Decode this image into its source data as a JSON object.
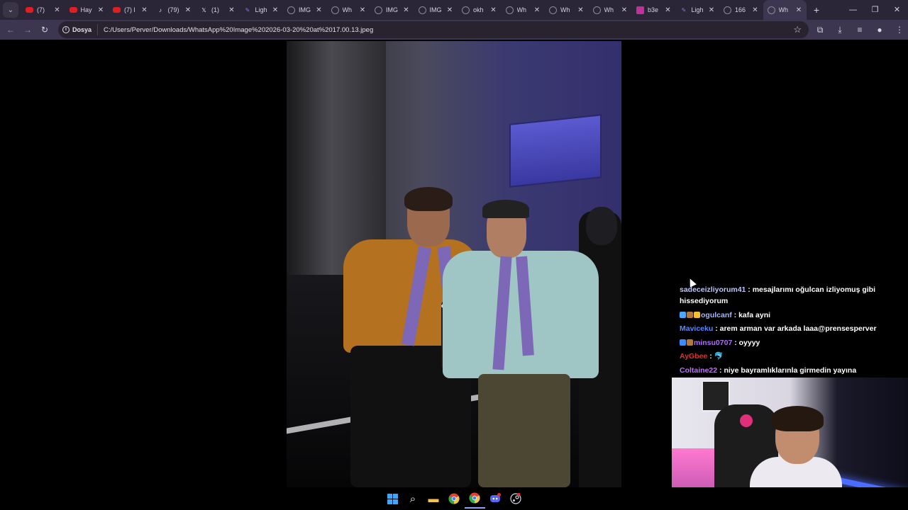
{
  "browser": {
    "tabs": [
      {
        "label": "(7) ",
        "favicon": "youtube-icon",
        "color": "#e02020"
      },
      {
        "label": "Hay",
        "favicon": "youtube-icon",
        "color": "#e02020"
      },
      {
        "label": "(7) l",
        "favicon": "youtube-icon",
        "color": "#e02020"
      },
      {
        "label": "(79)",
        "favicon": "tiktok-icon",
        "color": "#111111"
      },
      {
        "label": "(1) ",
        "favicon": "x-icon",
        "color": "#111111"
      },
      {
        "label": "Ligh",
        "favicon": "quill-icon",
        "color": "#8a7ad8"
      },
      {
        "label": "IMG",
        "favicon": "globe-icon",
        "color": "#8c8899"
      },
      {
        "label": "Wh",
        "favicon": "globe-icon",
        "color": "#8c8899"
      },
      {
        "label": "IMG",
        "favicon": "globe-icon",
        "color": "#8c8899"
      },
      {
        "label": "IMG",
        "favicon": "globe-icon",
        "color": "#8c8899"
      },
      {
        "label": "okh",
        "favicon": "globe-icon",
        "color": "#8c8899"
      },
      {
        "label": "Wh",
        "favicon": "globe-icon",
        "color": "#8c8899"
      },
      {
        "label": "Wh",
        "favicon": "globe-icon",
        "color": "#8c8899"
      },
      {
        "label": "Wh",
        "favicon": "globe-icon",
        "color": "#8c8899"
      },
      {
        "label": "b3e",
        "favicon": "hashtag-icon",
        "color": "#c2309a"
      },
      {
        "label": "Ligh",
        "favicon": "quill-icon",
        "color": "#8a7ad8"
      },
      {
        "label": "166",
        "favicon": "globe-icon",
        "color": "#8c8899"
      },
      {
        "label": "Wh",
        "favicon": "globe-icon",
        "color": "#8c8899",
        "active": true
      }
    ],
    "site_chip": "Dosya",
    "url": "C:/Users/Perver/Downloads/WhatsApp%20Image%202026-03-20%20at%2017.00.13.jpeg"
  },
  "chat": [
    {
      "user": "sadeceizliyorum41",
      "user_color": "#b9c4ff",
      "text": " : mesajlarımı oğulcan izliyomuş gibi hissediyorum",
      "badges": []
    },
    {
      "user": "ogulcanf",
      "user_color": "#a7b6ff",
      "text": " : kafa ayni",
      "badges": [
        "#4aa8ff",
        "#b07a3a",
        "#f0c030"
      ]
    },
    {
      "user": "Maviceku",
      "user_color": "#5c86ff",
      "text": " : arem arman var arkada laaa@prensesperver",
      "badges": []
    },
    {
      "user": "minsu0707",
      "user_color": "#b06cff",
      "text": " : oyyyy",
      "badges": [
        "#3a8cff",
        "#b07a3a"
      ]
    },
    {
      "user": "AyGbee",
      "user_color": "#e03030",
      "text": " : ",
      "emote": "🐬",
      "badges": []
    },
    {
      "user": "Coltaine22",
      "user_color": "#c070ff",
      "text": " : niye bayramlıklarınla girmedin yayına",
      "badges": []
    }
  ],
  "taskbar": {
    "apps": [
      "windows-start-icon",
      "search-icon",
      "file-explorer-icon",
      "chrome-icon",
      "chrome-alt-icon",
      "discord-icon",
      "steam-icon"
    ]
  }
}
